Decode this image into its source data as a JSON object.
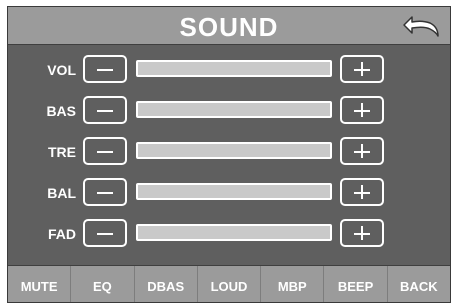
{
  "header": {
    "title": "SOUND",
    "back_icon": "back-arrow-icon"
  },
  "rows": [
    {
      "label": "VOL",
      "minus_icon": "minus-icon",
      "plus_icon": "plus-icon",
      "level": 0
    },
    {
      "label": "BAS",
      "minus_icon": "minus-icon",
      "plus_icon": "plus-icon",
      "level": 0
    },
    {
      "label": "TRE",
      "minus_icon": "minus-icon",
      "plus_icon": "plus-icon",
      "level": 0
    },
    {
      "label": "BAL",
      "minus_icon": "minus-icon",
      "plus_icon": "plus-icon",
      "level": 0
    },
    {
      "label": "FAD",
      "minus_icon": "minus-icon",
      "plus_icon": "plus-icon",
      "level": 0
    }
  ],
  "footer": {
    "tabs": [
      "MUTE",
      "EQ",
      "DBAS",
      "LOUD",
      "MBP",
      "BEEP",
      "BACK"
    ]
  },
  "colors": {
    "panel": "#5f5f5f",
    "header": "#9b9b9b",
    "bar": "#c9c9c9",
    "text": "#ffffff"
  }
}
